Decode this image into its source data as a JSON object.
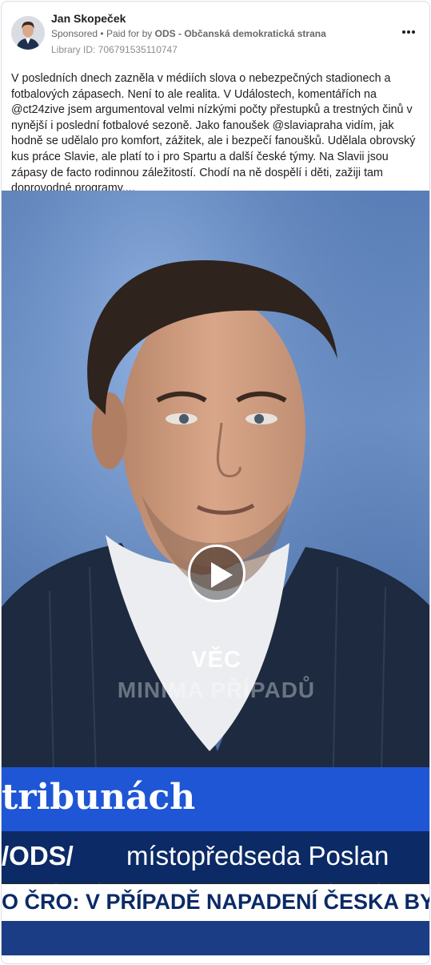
{
  "post": {
    "author": "Jan Skopeček",
    "sponsored_label": "Sponsored",
    "separator": "•",
    "paid_for_by": "Paid for by",
    "payer": "ODS - Občanská demokratická strana",
    "library_id": "Library ID: 706791535110747",
    "text": "V posledních dnech zazněla v médiích slova o nebezpečných stadionech a fotbalových zápasech. Není to ale realita. V Událostech, komentářích na @ct24zive jsem argumentoval velmi nízkými počty přestupků a trestných činů v nynější i poslední fotbalové sezoně. Jako fanoušek @slaviapraha vidím, jak hodně se udělalo pro komfort, zážitek, ale i bezpečí fanoušků. Udělala obrovský kus práce Slavie, ale platí to i pro Spartu a další české týmy. Na Slavii jsou zápasy de facto rodinnou záležitostí. Chodí na ně dospělí i děti, zažiji tam doprovodné programy...."
  },
  "video": {
    "overlay_title": "VĚC",
    "overlay_subtitle": "MINIMA PŘÍPADŮ",
    "band_headline": "tribunách",
    "band_party": "/ODS/",
    "band_role": "místopředseda Poslan",
    "ticker": "O ČRO: V PŘÍPADĚ NAPADENÍ ČESKA BY SE"
  },
  "icons": {
    "avatar": "avatar-photo",
    "more": "more-options-icon",
    "play": "play-icon"
  },
  "colors": {
    "band_primary": "#1f56d6",
    "band_dark": "#0b2a66",
    "ticker_bg": "#ffffff",
    "meta_text": "#65676b"
  }
}
